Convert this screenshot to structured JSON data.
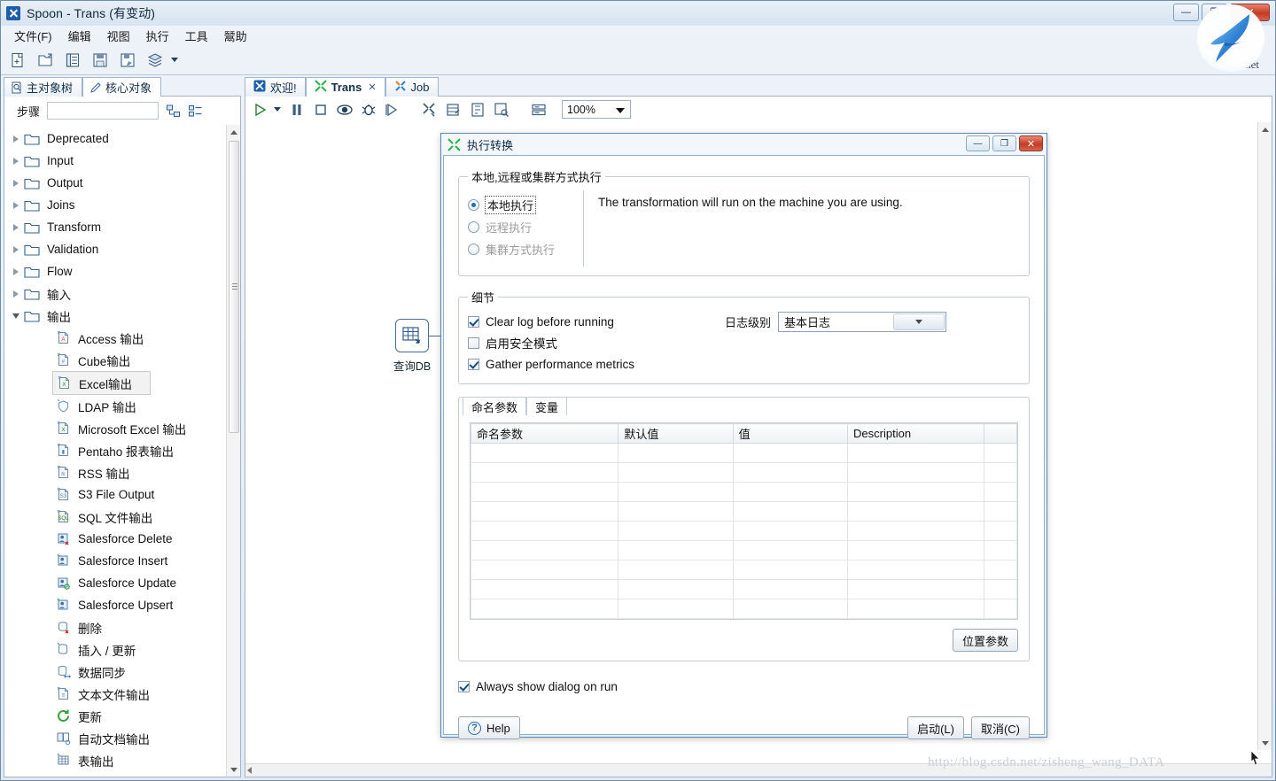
{
  "window": {
    "title": "Spoon - Trans (有变动)",
    "app_icon": "spoon-icon",
    "min_label": "—",
    "max_label": "❐",
    "close_label": "✕"
  },
  "menu": {
    "items": [
      {
        "label": "文件(F)",
        "name": "menu-file"
      },
      {
        "label": "编辑",
        "name": "menu-edit"
      },
      {
        "label": "视图",
        "name": "menu-view"
      },
      {
        "label": "执行",
        "name": "menu-run"
      },
      {
        "label": "工具",
        "name": "menu-tools"
      },
      {
        "label": "鬵助",
        "name": "menu-help"
      }
    ]
  },
  "toolbar": {
    "icons": [
      {
        "name": "new-file-icon"
      },
      {
        "name": "open-file-icon"
      },
      {
        "name": "explorer-icon"
      },
      {
        "name": "save-icon"
      },
      {
        "name": "save-as-icon"
      },
      {
        "name": "layers-icon"
      },
      {
        "name": "dropdown-caret-icon"
      }
    ]
  },
  "left_panel": {
    "tabs": [
      {
        "label": "主对象树",
        "icon": "document-search-icon",
        "active": false
      },
      {
        "label": "核心对象",
        "icon": "pencil-icon",
        "active": true
      }
    ],
    "search": {
      "label": "步骤",
      "value": "",
      "placeholder": ""
    },
    "tool_icons": [
      {
        "name": "expand-all-icon"
      },
      {
        "name": "collapse-all-icon"
      }
    ],
    "tree": [
      {
        "label": "Deprecated",
        "type": "folder",
        "expanded": false
      },
      {
        "label": "Input",
        "type": "folder",
        "expanded": false
      },
      {
        "label": "Output",
        "type": "folder",
        "expanded": false
      },
      {
        "label": "Joins",
        "type": "folder",
        "expanded": false
      },
      {
        "label": "Transform",
        "type": "folder",
        "expanded": false
      },
      {
        "label": "Validation",
        "type": "folder",
        "expanded": false
      },
      {
        "label": "Flow",
        "type": "folder",
        "expanded": false
      },
      {
        "label": "输入",
        "type": "folder",
        "expanded": false
      },
      {
        "label": "输出",
        "type": "folder",
        "expanded": true
      },
      {
        "label": "Access 输出",
        "type": "leaf",
        "icon": "access-output-icon"
      },
      {
        "label": "Cube输出",
        "type": "leaf",
        "icon": "cube-output-icon"
      },
      {
        "label": "Excel输出",
        "type": "leaf",
        "icon": "excel-output-icon",
        "selected": true
      },
      {
        "label": "LDAP 输出",
        "type": "leaf",
        "icon": "ldap-output-icon"
      },
      {
        "label": "Microsoft Excel 输出",
        "type": "leaf",
        "icon": "ms-excel-output-icon"
      },
      {
        "label": "Pentaho 报表输出",
        "type": "leaf",
        "icon": "pentaho-report-output-icon"
      },
      {
        "label": "RSS 输出",
        "type": "leaf",
        "icon": "rss-output-icon"
      },
      {
        "label": "S3 File Output",
        "type": "leaf",
        "icon": "s3-file-output-icon"
      },
      {
        "label": "SQL 文件输出",
        "type": "leaf",
        "icon": "sql-file-output-icon"
      },
      {
        "label": "Salesforce Delete",
        "type": "leaf",
        "icon": "salesforce-delete-icon"
      },
      {
        "label": "Salesforce Insert",
        "type": "leaf",
        "icon": "salesforce-insert-icon"
      },
      {
        "label": "Salesforce Update",
        "type": "leaf",
        "icon": "salesforce-update-icon"
      },
      {
        "label": "Salesforce Upsert",
        "type": "leaf",
        "icon": "salesforce-upsert-icon"
      },
      {
        "label": "删除",
        "type": "leaf",
        "icon": "delete-icon"
      },
      {
        "label": "插入 / 更新",
        "type": "leaf",
        "icon": "insert-update-icon"
      },
      {
        "label": "数据同步",
        "type": "leaf",
        "icon": "sync-icon"
      },
      {
        "label": "文本文件输出",
        "type": "leaf",
        "icon": "text-file-output-icon"
      },
      {
        "label": "更新",
        "type": "leaf",
        "icon": "update-icon"
      },
      {
        "label": "自动文档输出",
        "type": "leaf",
        "icon": "auto-doc-output-icon"
      },
      {
        "label": "表输出",
        "type": "leaf",
        "icon": "table-output-icon"
      }
    ]
  },
  "editor": {
    "tabs": [
      {
        "label": "欢迎!",
        "icon": "welcome-icon",
        "active": false,
        "closable": false
      },
      {
        "label": "Trans",
        "icon": "trans-icon",
        "active": true,
        "closable": true,
        "close_label": "✕"
      },
      {
        "label": "Job",
        "icon": "job-icon",
        "active": false,
        "closable": false
      }
    ],
    "toolbar_icons": [
      {
        "name": "run-icon"
      },
      {
        "name": "run-dropdown-caret-icon"
      },
      {
        "name": "pause-icon"
      },
      {
        "name": "stop-icon"
      },
      {
        "name": "preview-icon"
      },
      {
        "name": "debug-icon"
      },
      {
        "name": "replay-icon"
      },
      {
        "name": "trans-settings-icon"
      },
      {
        "name": "show-grid-icon"
      },
      {
        "name": "show-impact-icon"
      },
      {
        "name": "show-sql-icon"
      },
      {
        "name": "align-icon"
      }
    ],
    "zoom": {
      "value": "100%",
      "name": "zoom-combo"
    },
    "canvas": {
      "steps": [
        {
          "label": "查询DB",
          "icon": "database-lookup-icon"
        }
      ]
    }
  },
  "dialog": {
    "title": "执行转换",
    "icon": "trans-icon",
    "min_label": "—",
    "max_label": "❐",
    "close_label": "✕",
    "exec_group": {
      "legend": "本地,远程或集群方式执行",
      "options": [
        {
          "label": "本地执行",
          "checked": true,
          "disabled": false
        },
        {
          "label": "远程执行",
          "checked": false,
          "disabled": true
        },
        {
          "label": "集群方式执行",
          "checked": false,
          "disabled": true
        }
      ],
      "description": "The transformation will run on the machine you are using."
    },
    "details_group": {
      "legend": "细节",
      "checkboxes": [
        {
          "label": "Clear log before running",
          "checked": true
        },
        {
          "label": "启用安全模式",
          "checked": false
        },
        {
          "label": "Gather performance metrics",
          "checked": true
        }
      ],
      "log_level": {
        "label": "日志级别",
        "value": "基本日志"
      }
    },
    "params_group": {
      "tabs": [
        {
          "label": "命名参数",
          "active": true
        },
        {
          "label": "变量",
          "active": false
        }
      ],
      "columns": [
        "命名参数",
        "默认值",
        "值",
        "Description"
      ],
      "rows": [],
      "empty_row_count": 9,
      "position_params_button": "位置参数"
    },
    "always_show": {
      "label": "Always show dialog on run",
      "checked": true
    },
    "footer": {
      "help": "Help",
      "start": "启动(L)",
      "cancel": "取消(C)"
    }
  },
  "watermark": {
    "bird": "bird-logo",
    "corner_text": ".net",
    "bottom_url": "http://blog.csdn.net/zisheng_wang_DATA"
  },
  "colors": {
    "accent": "#1b6fc4",
    "title_text": "#12283f",
    "close_red": "#c53a22",
    "panel_border": "#9fb6cc",
    "canvas_bg": "#ffffff"
  }
}
